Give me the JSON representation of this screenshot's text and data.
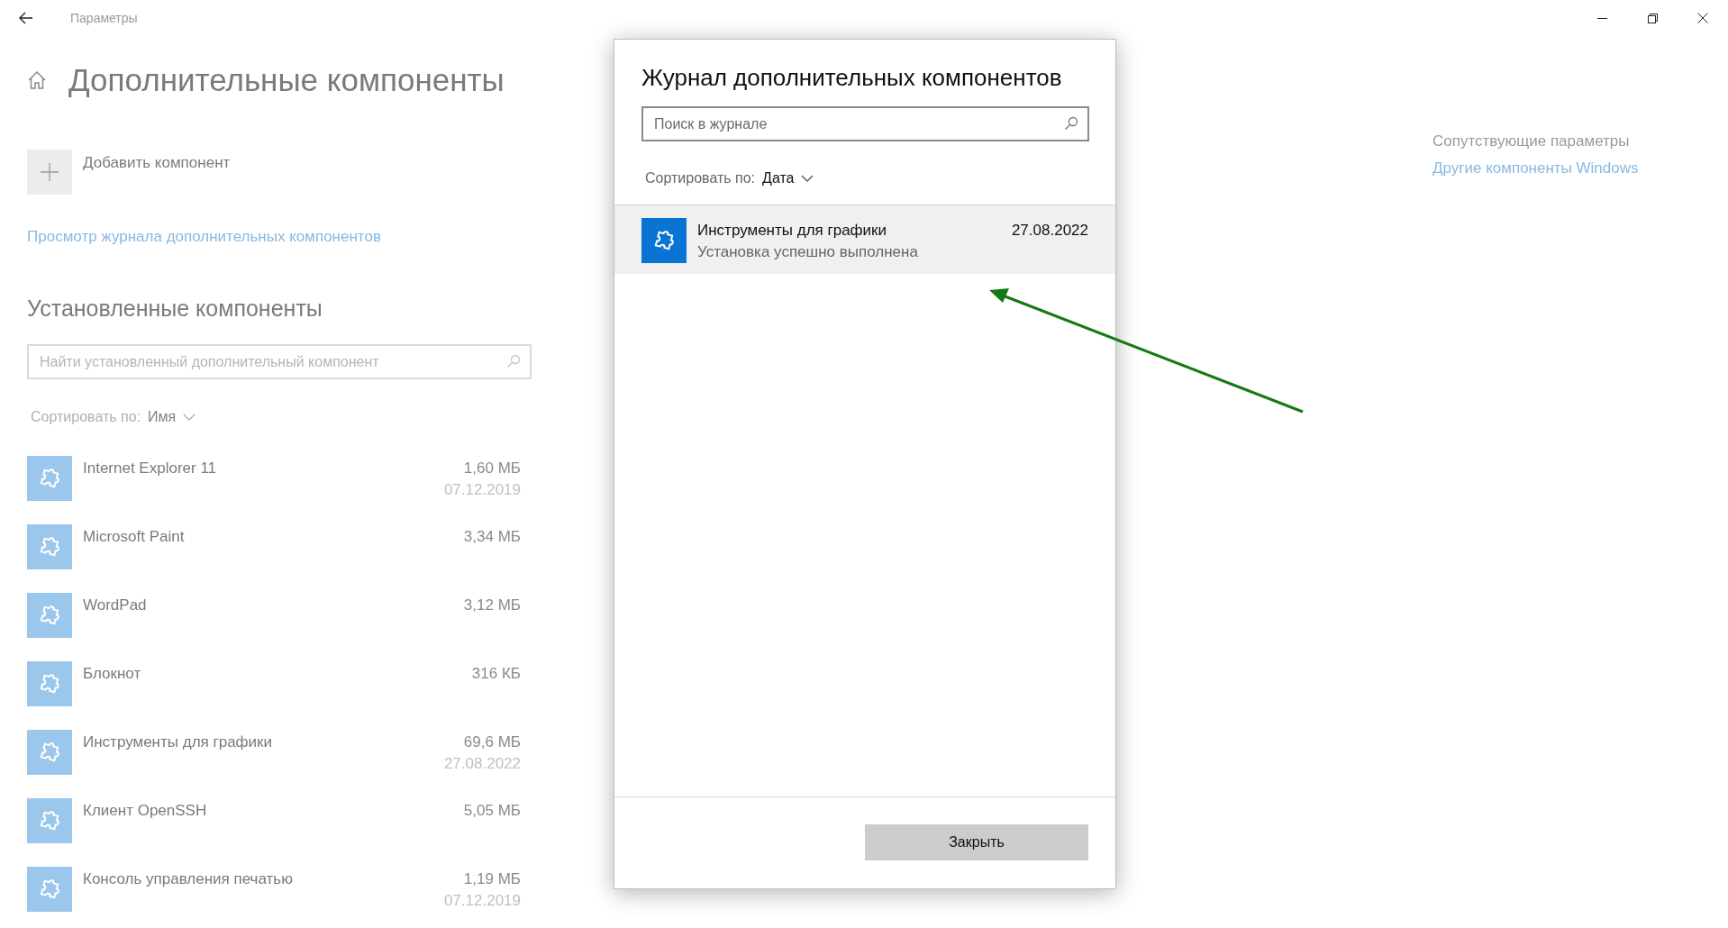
{
  "window": {
    "title": "Параметры"
  },
  "page": {
    "heading": "Дополнительные компоненты",
    "add_button": "Добавить компонент",
    "history_link": "Просмотр журнала дополнительных компонентов",
    "installed_heading": "Установленные компоненты",
    "search": {
      "placeholder": "Найти установленный дополнительный компонент"
    },
    "sort": {
      "label": "Сортировать по:",
      "value": "Имя"
    },
    "components": [
      {
        "name": "Internet Explorer 11",
        "size": "1,60 МБ",
        "date": "07.12.2019"
      },
      {
        "name": "Microsoft Paint",
        "size": "3,34 МБ"
      },
      {
        "name": "WordPad",
        "size": "3,12 МБ"
      },
      {
        "name": "Блокнот",
        "size": "316 КБ"
      },
      {
        "name": "Инструменты для графики",
        "size": "69,6 МБ",
        "date": "27.08.2022"
      },
      {
        "name": "Клиент OpenSSH",
        "size": "5,05 МБ"
      },
      {
        "name": "Консоль управления печатью",
        "size": "1,19 МБ",
        "date": "07.12.2019"
      }
    ]
  },
  "related": {
    "heading": "Сопутствующие параметры",
    "link": "Другие компоненты Windows"
  },
  "dialog": {
    "title": "Журнал дополнительных компонентов",
    "search": {
      "placeholder": "Поиск в журнале"
    },
    "sort": {
      "label": "Сортировать по:",
      "value": "Дата"
    },
    "entries": [
      {
        "name": "Инструменты для графики",
        "status": "Установка успешно выполнена",
        "date": "27.08.2022",
        "selected": true
      }
    ],
    "close_button": "Закрыть"
  }
}
